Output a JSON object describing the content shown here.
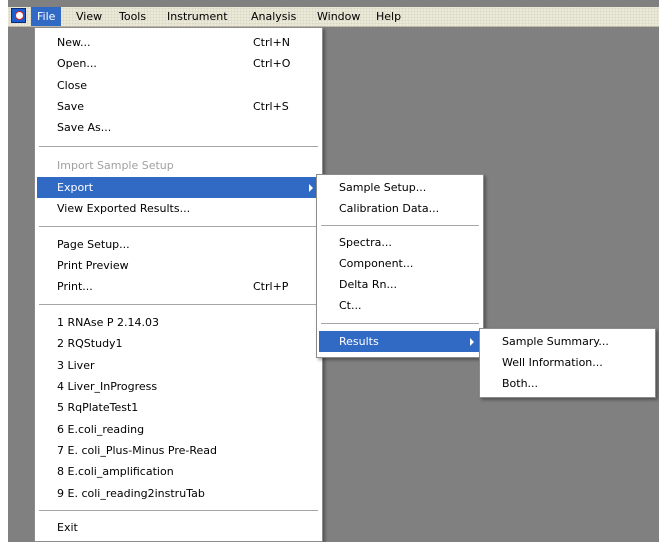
{
  "menubar": {
    "items": [
      "File",
      "View",
      "Tools",
      "Instrument",
      "Analysis",
      "Window",
      "Help"
    ]
  },
  "file_menu": {
    "new": {
      "label": "New...",
      "accel": "Ctrl+N"
    },
    "open": {
      "label": "Open...",
      "accel": "Ctrl+O"
    },
    "close": {
      "label": "Close"
    },
    "save": {
      "label": "Save",
      "accel": "Ctrl+S"
    },
    "save_as": {
      "label": "Save As..."
    },
    "import_sample_setup": {
      "label": "Import Sample Setup",
      "disabled": true
    },
    "export": {
      "label": "Export"
    },
    "view_exported_results": {
      "label": "View Exported Results..."
    },
    "page_setup": {
      "label": "Page Setup..."
    },
    "print_preview": {
      "label": "Print Preview"
    },
    "print": {
      "label": "Print...",
      "accel": "Ctrl+P"
    },
    "recent_files": [
      "1 RNAse P 2.14.03",
      "2 RQStudy1",
      "3 Liver",
      "4 Liver_InProgress",
      "5 RqPlateTest1",
      "6 E.coli_reading",
      "7 E. coli_Plus-Minus Pre-Read",
      "8 E.coli_amplification",
      "9 E. coli_reading2instruTab"
    ],
    "exit": {
      "label": "Exit"
    }
  },
  "export_menu": {
    "sample_setup": "Sample Setup...",
    "calibration_data": "Calibration Data...",
    "spectra": "Spectra...",
    "component": "Component...",
    "delta_rn": "Delta Rn...",
    "ct": "Ct...",
    "results": "Results"
  },
  "results_menu": {
    "sample_summary": "Sample Summary...",
    "well_information": "Well Information...",
    "both": "Both..."
  },
  "colors": {
    "highlight": "#316ac5",
    "workspace": "#808080",
    "menubar": "#ece9d8"
  },
  "icons": [
    "app-icon",
    "submenu-arrow-icon"
  ]
}
